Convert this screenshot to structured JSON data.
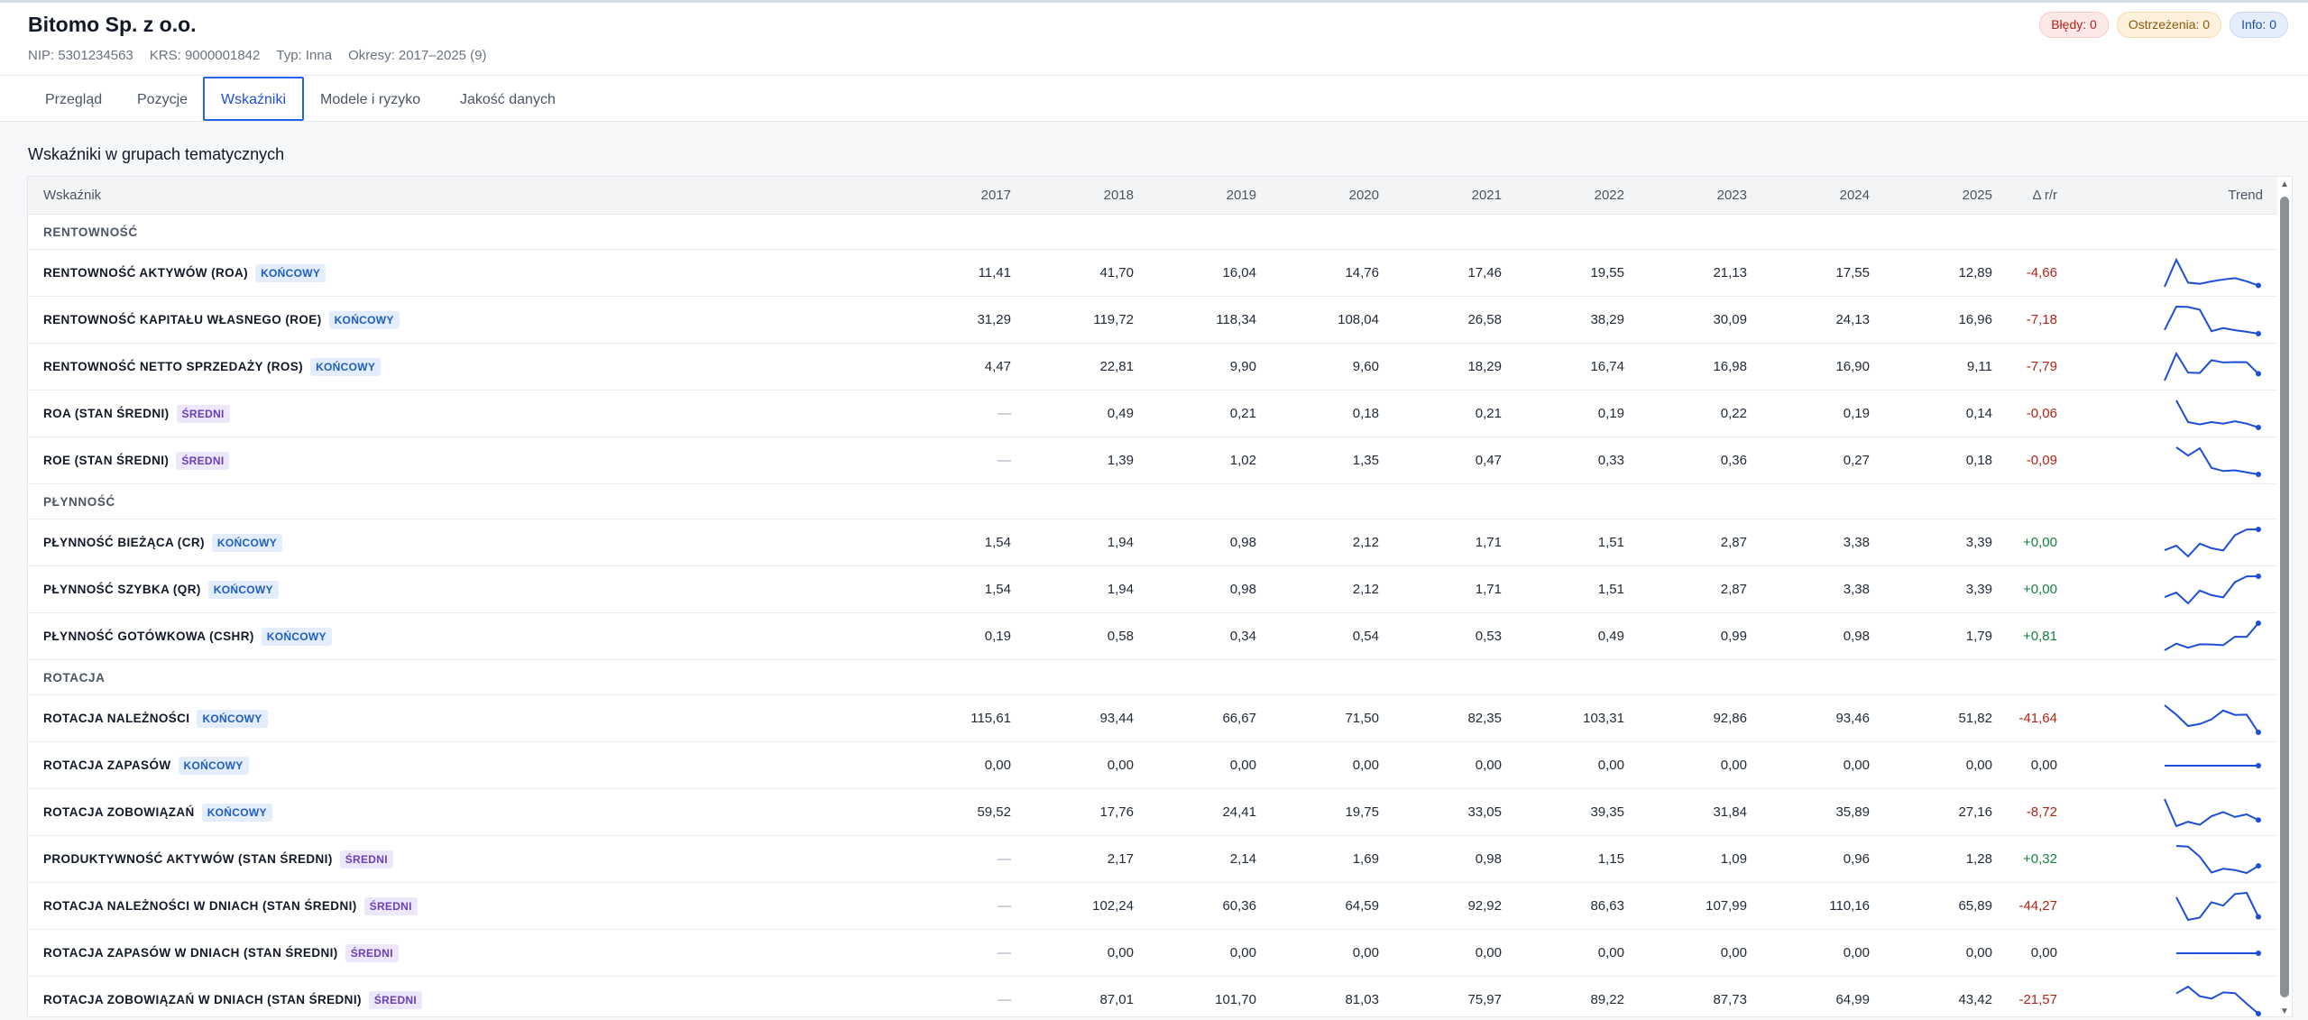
{
  "company": {
    "name": "Bitomo Sp. z o.o.",
    "nip": "NIP: 5301234563",
    "krs": "KRS: 9000001842",
    "type": "Typ: Inna",
    "periods": "Okresy: 2017–2025 (9)"
  },
  "badges": {
    "errors": "Błędy: 0",
    "warnings": "Ostrzeżenia: 0",
    "info": "Info: 0"
  },
  "colors": {
    "accent": "#2563eb",
    "negative": "#b42318",
    "positive": "#15803d",
    "sparkline": "#1d4ed8"
  },
  "tabs": [
    {
      "label": "Przegląd"
    },
    {
      "label": "Pozycje"
    },
    {
      "label": "Wskaźniki",
      "active": true
    },
    {
      "label": "Modele i ryzyko"
    },
    {
      "label": "Jakość danych"
    }
  ],
  "section_title": "Wskaźniki w grupach tematycznych",
  "table": {
    "headers": {
      "indicator": "Wskaźnik",
      "years": [
        "2017",
        "2018",
        "2019",
        "2020",
        "2021",
        "2022",
        "2023",
        "2024",
        "2025"
      ],
      "delta": "Δ r/r",
      "trend": "Trend"
    },
    "groups": [
      {
        "name": "RENTOWNOŚĆ",
        "rows": [
          {
            "name": "RENTOWNOŚĆ AKTYWÓW (ROA)",
            "tag": "KOŃCOWY",
            "tag_type": "kon",
            "values": [
              "11,41",
              "41,70",
              "16,04",
              "14,76",
              "17,46",
              "19,55",
              "21,13",
              "17,55",
              "12,89"
            ],
            "delta": "-4,66",
            "trend": [
              11.41,
              41.7,
              16.04,
              14.76,
              17.46,
              19.55,
              21.13,
              17.55,
              12.89
            ]
          },
          {
            "name": "RENTOWNOŚĆ KAPITAŁU WŁASNEGO (ROE)",
            "tag": "KOŃCOWY",
            "tag_type": "kon",
            "values": [
              "31,29",
              "119,72",
              "118,34",
              "108,04",
              "26,58",
              "38,29",
              "30,09",
              "24,13",
              "16,96"
            ],
            "delta": "-7,18",
            "trend": [
              31.29,
              119.72,
              118.34,
              108.04,
              26.58,
              38.29,
              30.09,
              24.13,
              16.96
            ]
          },
          {
            "name": "RENTOWNOŚĆ NETTO SPRZEDAŻY (ROS)",
            "tag": "KOŃCOWY",
            "tag_type": "kon",
            "values": [
              "4,47",
              "22,81",
              "9,90",
              "9,60",
              "18,29",
              "16,74",
              "16,98",
              "16,90",
              "9,11"
            ],
            "delta": "-7,79",
            "trend": [
              4.47,
              22.81,
              9.9,
              9.6,
              18.29,
              16.74,
              16.98,
              16.9,
              9.11
            ]
          },
          {
            "name": "ROA (STAN ŚREDNI)",
            "tag": "ŚREDNI",
            "tag_type": "sre",
            "values": [
              "—",
              "0,49",
              "0,21",
              "0,18",
              "0,21",
              "0,19",
              "0,22",
              "0,19",
              "0,14"
            ],
            "delta": "-0,06",
            "trend": [
              null,
              0.49,
              0.21,
              0.18,
              0.21,
              0.19,
              0.22,
              0.19,
              0.14
            ]
          },
          {
            "name": "ROE (STAN ŚREDNI)",
            "tag": "ŚREDNI",
            "tag_type": "sre",
            "values": [
              "—",
              "1,39",
              "1,02",
              "1,35",
              "0,47",
              "0,33",
              "0,36",
              "0,27",
              "0,18"
            ],
            "delta": "-0,09",
            "trend": [
              null,
              1.39,
              1.02,
              1.35,
              0.47,
              0.33,
              0.36,
              0.27,
              0.18
            ]
          }
        ]
      },
      {
        "name": "PŁYNNOŚĆ",
        "rows": [
          {
            "name": "PŁYNNOŚĆ BIEŻĄCA (CR)",
            "tag": "KOŃCOWY",
            "tag_type": "kon",
            "values": [
              "1,54",
              "1,94",
              "0,98",
              "2,12",
              "1,71",
              "1,51",
              "2,87",
              "3,38",
              "3,39"
            ],
            "delta": "+0,00",
            "trend": [
              1.54,
              1.94,
              0.98,
              2.12,
              1.71,
              1.51,
              2.87,
              3.38,
              3.39
            ]
          },
          {
            "name": "PŁYNNOŚĆ SZYBKA (QR)",
            "tag": "KOŃCOWY",
            "tag_type": "kon",
            "values": [
              "1,54",
              "1,94",
              "0,98",
              "2,12",
              "1,71",
              "1,51",
              "2,87",
              "3,38",
              "3,39"
            ],
            "delta": "+0,00",
            "trend": [
              1.54,
              1.94,
              0.98,
              2.12,
              1.71,
              1.51,
              2.87,
              3.38,
              3.39
            ]
          },
          {
            "name": "PŁYNNOŚĆ GOTÓWKOWA (CSHR)",
            "tag": "KOŃCOWY",
            "tag_type": "kon",
            "values": [
              "0,19",
              "0,58",
              "0,34",
              "0,54",
              "0,53",
              "0,49",
              "0,99",
              "0,98",
              "1,79"
            ],
            "delta": "+0,81",
            "trend": [
              0.19,
              0.58,
              0.34,
              0.54,
              0.53,
              0.49,
              0.99,
              0.98,
              1.79
            ]
          }
        ]
      },
      {
        "name": "ROTACJA",
        "rows": [
          {
            "name": "ROTACJA NALEŻNOŚCI",
            "tag": "KOŃCOWY",
            "tag_type": "kon",
            "values": [
              "115,61",
              "93,44",
              "66,67",
              "71,50",
              "82,35",
              "103,31",
              "92,86",
              "93,46",
              "51,82"
            ],
            "delta": "-41,64",
            "trend": [
              115.61,
              93.44,
              66.67,
              71.5,
              82.35,
              103.31,
              92.86,
              93.46,
              51.82
            ]
          },
          {
            "name": "ROTACJA ZAPASÓW",
            "tag": "KOŃCOWY",
            "tag_type": "kon",
            "values": [
              "0,00",
              "0,00",
              "0,00",
              "0,00",
              "0,00",
              "0,00",
              "0,00",
              "0,00",
              "0,00"
            ],
            "delta": "0,00",
            "trend": [
              0,
              0,
              0,
              0,
              0,
              0,
              0,
              0,
              0
            ]
          },
          {
            "name": "ROTACJA ZOBOWIĄZAŃ",
            "tag": "KOŃCOWY",
            "tag_type": "kon",
            "values": [
              "59,52",
              "17,76",
              "24,41",
              "19,75",
              "33,05",
              "39,35",
              "31,84",
              "35,89",
              "27,16"
            ],
            "delta": "-8,72",
            "trend": [
              59.52,
              17.76,
              24.41,
              19.75,
              33.05,
              39.35,
              31.84,
              35.89,
              27.16
            ]
          },
          {
            "name": "PRODUKTYWNOŚĆ AKTYWÓW (STAN ŚREDNI)",
            "tag": "ŚREDNI",
            "tag_type": "sre",
            "values": [
              "—",
              "2,17",
              "2,14",
              "1,69",
              "0,98",
              "1,15",
              "1,09",
              "0,96",
              "1,28"
            ],
            "delta": "+0,32",
            "trend": [
              null,
              2.17,
              2.14,
              1.69,
              0.98,
              1.15,
              1.09,
              0.96,
              1.28
            ]
          },
          {
            "name": "ROTACJA NALEŻNOŚCI W DNIACH (STAN ŚREDNI)",
            "tag": "ŚREDNI",
            "tag_type": "sre",
            "values": [
              "—",
              "102,24",
              "60,36",
              "64,59",
              "92,92",
              "86,63",
              "107,99",
              "110,16",
              "65,89"
            ],
            "delta": "-44,27",
            "trend": [
              null,
              102.24,
              60.36,
              64.59,
              92.92,
              86.63,
              107.99,
              110.16,
              65.89
            ]
          },
          {
            "name": "ROTACJA ZAPASÓW W DNIACH (STAN ŚREDNI)",
            "tag": "ŚREDNI",
            "tag_type": "sre",
            "values": [
              "—",
              "0,00",
              "0,00",
              "0,00",
              "0,00",
              "0,00",
              "0,00",
              "0,00",
              "0,00"
            ],
            "delta": "0,00",
            "trend": [
              null,
              0,
              0,
              0,
              0,
              0,
              0,
              0,
              0
            ]
          },
          {
            "name": "ROTACJA ZOBOWIĄZAŃ W DNIACH (STAN ŚREDNI)",
            "tag": "ŚREDNI",
            "tag_type": "sre",
            "values": [
              "—",
              "87,01",
              "101,70",
              "81,03",
              "75,97",
              "89,22",
              "87,73",
              "64,99",
              "43,42"
            ],
            "delta": "-21,57",
            "trend": [
              null,
              87.01,
              101.7,
              81.03,
              75.97,
              89.22,
              87.73,
              64.99,
              43.42
            ]
          }
        ]
      }
    ]
  }
}
